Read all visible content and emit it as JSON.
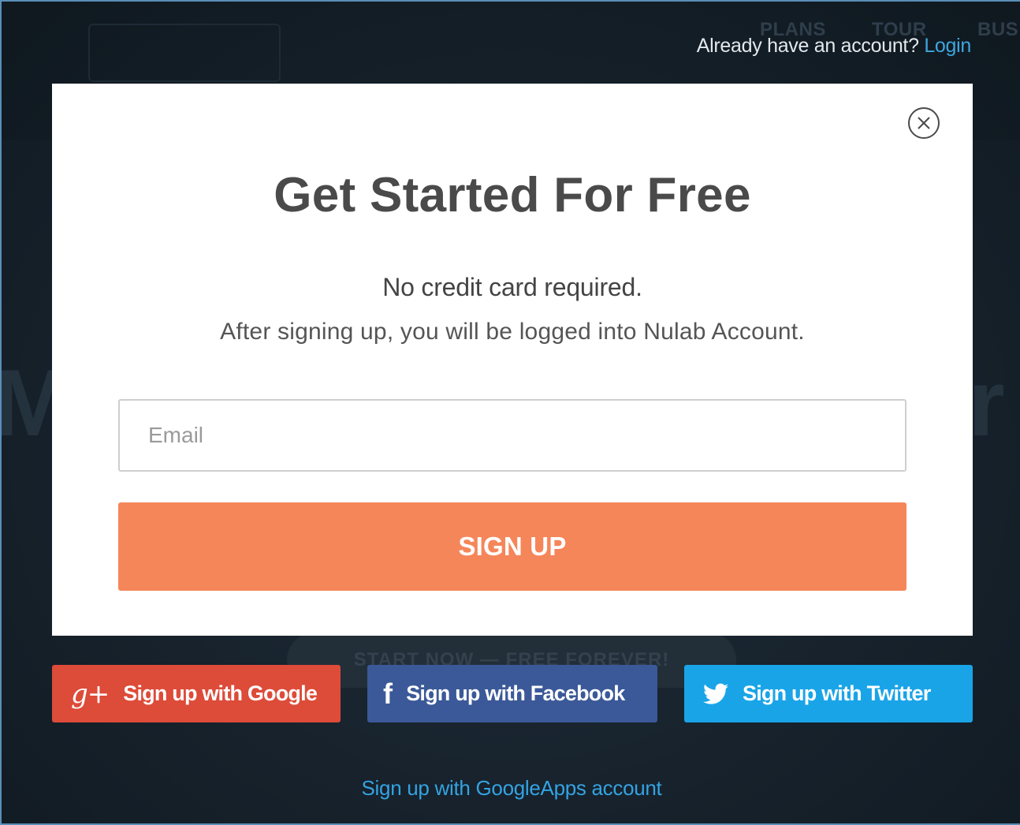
{
  "header": {
    "account_prompt": "Already have an account?",
    "login_link": "Login"
  },
  "background": {
    "nav_items": [
      "PLANS",
      "TOUR",
      "BUS"
    ],
    "hero_fragments": [
      "M",
      "r"
    ],
    "cta_text": "START NOW — FREE FOREVER!"
  },
  "modal": {
    "title": "Get Started For Free",
    "subtitle": "No credit card required.",
    "description": "After signing up, you will be logged into Nulab Account.",
    "email_placeholder": "Email",
    "email_value": "",
    "signup_label": "SIGN UP",
    "close_icon": "close-circle-icon"
  },
  "social": {
    "google": {
      "label": "Sign up with Google",
      "icon": "google-plus-icon",
      "glyph": "g+",
      "color": "#dd4b39"
    },
    "facebook": {
      "label": "Sign up with Facebook",
      "icon": "facebook-icon",
      "glyph": "f",
      "color": "#3b5998"
    },
    "twitter": {
      "label": "Sign up with Twitter",
      "icon": "twitter-bird-icon",
      "color": "#1aa4e8"
    }
  },
  "googleapps_link": "Sign up with GoogleApps account",
  "colors": {
    "accent": "#f5865a",
    "link": "#3fa6e0",
    "overlay_bg": "#16202a"
  }
}
